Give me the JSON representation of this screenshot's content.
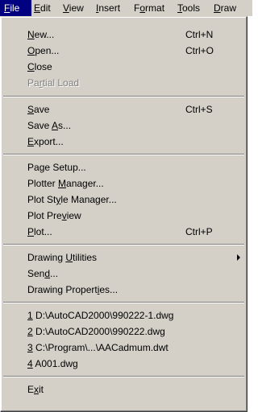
{
  "menubar": {
    "items": [
      {
        "before": "",
        "key": "F",
        "after": "ile"
      },
      {
        "before": "",
        "key": "E",
        "after": "dit"
      },
      {
        "before": "",
        "key": "V",
        "after": "iew"
      },
      {
        "before": "",
        "key": "I",
        "after": "nsert"
      },
      {
        "before": "F",
        "key": "o",
        "after": "rmat"
      },
      {
        "before": "",
        "key": "T",
        "after": "ools"
      },
      {
        "before": "",
        "key": "D",
        "after": "raw"
      }
    ]
  },
  "file_menu": {
    "items": [
      {
        "before": "",
        "key": "N",
        "after": "ew...",
        "shortcut": "Ctrl+N"
      },
      {
        "before": "",
        "key": "O",
        "after": "pen...",
        "shortcut": "Ctrl+O"
      },
      {
        "before": "",
        "key": "C",
        "after": "lose",
        "shortcut": ""
      },
      {
        "before": "Pa",
        "key": "r",
        "after": "tial Load",
        "shortcut": ""
      },
      {
        "before": "",
        "key": "S",
        "after": "ave",
        "shortcut": "Ctrl+S"
      },
      {
        "before": "Save ",
        "key": "A",
        "after": "s...",
        "shortcut": ""
      },
      {
        "before": "",
        "key": "E",
        "after": "xport...",
        "shortcut": ""
      },
      {
        "before": "Pa",
        "key": "g",
        "after": "e Setup...",
        "shortcut": ""
      },
      {
        "before": "Plotter ",
        "key": "M",
        "after": "anager...",
        "shortcut": ""
      },
      {
        "before": "Plot St",
        "key": "y",
        "after": "le Manager...",
        "shortcut": ""
      },
      {
        "before": "Plot Pre",
        "key": "v",
        "after": "iew",
        "shortcut": ""
      },
      {
        "before": "",
        "key": "P",
        "after": "lot...",
        "shortcut": "Ctrl+P"
      },
      {
        "before": "Drawing ",
        "key": "U",
        "after": "tilities",
        "shortcut": ""
      },
      {
        "before": "Sen",
        "key": "d",
        "after": "...",
        "shortcut": ""
      },
      {
        "before": "Drawing Propert",
        "key": "i",
        "after": "es...",
        "shortcut": ""
      },
      {
        "before": "",
        "key": "1",
        "after": " D:\\AutoCAD2000\\990222-1.dwg",
        "shortcut": ""
      },
      {
        "before": "",
        "key": "2",
        "after": " D:\\AutoCAD2000\\990222.dwg",
        "shortcut": ""
      },
      {
        "before": "",
        "key": "3",
        "after": " C:\\Program\\...\\AACadmum.dwt",
        "shortcut": ""
      },
      {
        "before": "",
        "key": "4",
        "after": " A001.dwg",
        "shortcut": ""
      },
      {
        "before": "E",
        "key": "x",
        "after": "it",
        "shortcut": ""
      }
    ]
  }
}
